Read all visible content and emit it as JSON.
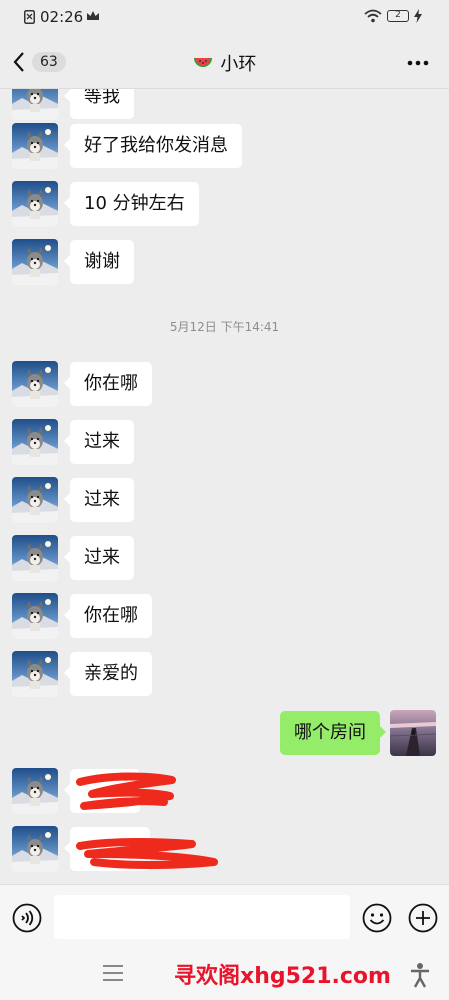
{
  "status_bar": {
    "time": "02:26",
    "battery": "2"
  },
  "header": {
    "unread_count": "63",
    "title": "小环",
    "title_emoji": "watermelon-emoji"
  },
  "messages": [
    {
      "side": "left",
      "text": "等我"
    },
    {
      "side": "left",
      "text": "好了我给你发消息"
    },
    {
      "side": "left",
      "text": "10 分钟左右"
    },
    {
      "side": "left",
      "text": "谢谢"
    },
    {
      "type": "timestamp",
      "text": "5月12日 下午14:41"
    },
    {
      "side": "left",
      "text": "你在哪"
    },
    {
      "side": "left",
      "text": "过来"
    },
    {
      "side": "left",
      "text": "过来"
    },
    {
      "side": "left",
      "text": "过来"
    },
    {
      "side": "left",
      "text": "你在哪"
    },
    {
      "side": "left",
      "text": "亲爱的"
    },
    {
      "side": "right",
      "text": "哪个房间"
    },
    {
      "side": "left",
      "text": "",
      "redacted": true
    },
    {
      "side": "left",
      "text": "",
      "redacted": true
    }
  ],
  "input": {
    "placeholder": ""
  },
  "watermark": "寻欢阁xhg521.com",
  "colors": {
    "background": "#ededed",
    "bubble_other": "#ffffff",
    "bubble_mine": "#95ec69",
    "redaction": "#ee2a1c",
    "watermark": "#e8142b"
  }
}
